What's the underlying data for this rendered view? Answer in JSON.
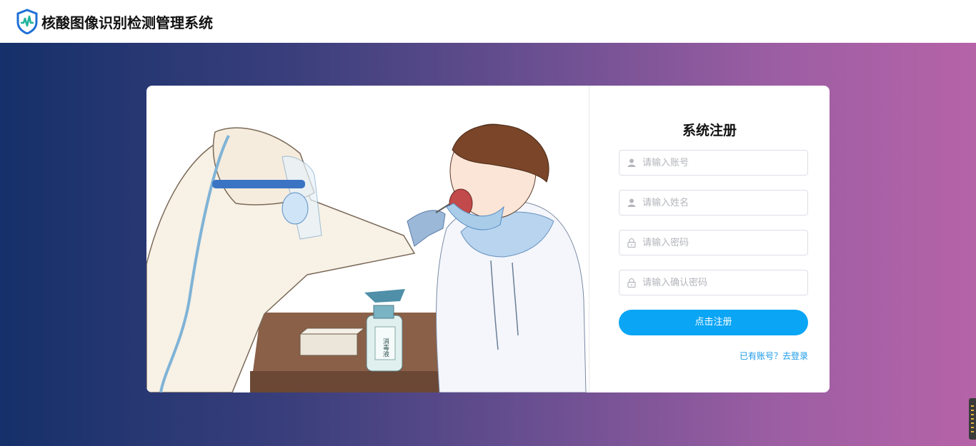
{
  "header": {
    "app_title": "核酸图像识别检测管理系统",
    "logo_icon": "shield-heartbeat-logo"
  },
  "illustration": {
    "bottle_label": "消毒液"
  },
  "register": {
    "title": "系统注册",
    "account_placeholder": "请输入账号",
    "name_placeholder": "请输入姓名",
    "password_placeholder": "请输入密码",
    "confirm_placeholder": "请输入确认密码",
    "submit_label": "点击注册",
    "login_link": "已有账号？去登录"
  },
  "colors": {
    "accent": "#0aa5f5",
    "link": "#1a9ae8",
    "gradient_start": "#15306a",
    "gradient_end": "#b663a8"
  }
}
